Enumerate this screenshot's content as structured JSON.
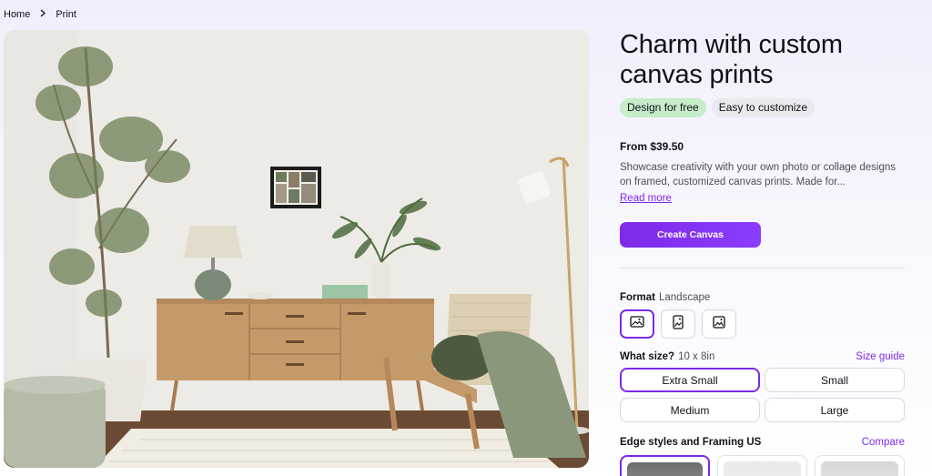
{
  "breadcrumb": {
    "home": "Home",
    "current": "Print"
  },
  "hero": {
    "alt": "Living room with a framed collage canvas print on the wall"
  },
  "product": {
    "title": "Charm with custom canvas prints",
    "badges": [
      "Design for free",
      "Easy to customize"
    ],
    "price": "From $39.50",
    "description": "Showcase creativity with your own photo or collage designs on framed, customized canvas prints. Made for...",
    "read_more": "Read more",
    "cta": "Create Canvas"
  },
  "format": {
    "label": "Format",
    "value": "Landscape",
    "options": [
      {
        "icon": "landscape-image-icon",
        "selected": true
      },
      {
        "icon": "portrait-image-icon",
        "selected": false
      },
      {
        "icon": "square-image-icon",
        "selected": false
      }
    ]
  },
  "size": {
    "label": "What size?",
    "value": "10 x 8in",
    "guide": "Size guide",
    "options": [
      "Extra Small",
      "Small",
      "Medium",
      "Large"
    ],
    "selected": "Extra Small"
  },
  "edges": {
    "label": "Edge styles and Framing US",
    "compare": "Compare"
  },
  "colors": {
    "accent": "#7d2ae8",
    "cta": "#8b3dff",
    "badge_green": "#c6ecc9",
    "badge_gray": "#e9e9ee"
  }
}
